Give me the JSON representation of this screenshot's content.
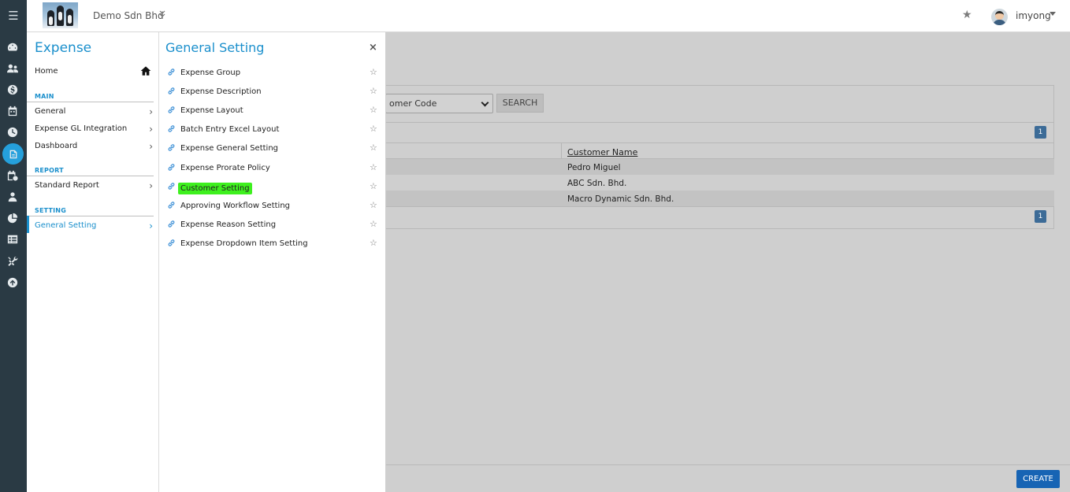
{
  "topbar": {
    "company": "Demo Sdn Bhd",
    "username": "imyong"
  },
  "rail": {
    "icons": [
      "menu-icon",
      "dashboard-icon",
      "users-icon",
      "dollar-icon",
      "calendar-icon",
      "clock-icon",
      "expense-icon",
      "calendar-check-icon",
      "person-icon",
      "pie-chart-icon",
      "table-icon",
      "tools-icon",
      "upload-icon"
    ],
    "active": "expense-icon"
  },
  "nav": {
    "title": "Expense",
    "home": "Home",
    "sections": [
      {
        "label": "MAIN",
        "items": [
          "General",
          "Expense GL Integration",
          "Dashboard"
        ]
      },
      {
        "label": "REPORT",
        "items": [
          "Standard Report"
        ]
      },
      {
        "label": "SETTING",
        "items": [
          "General Setting"
        ]
      }
    ],
    "active_item": "General Setting"
  },
  "flyout": {
    "title": "General Setting",
    "close": "×",
    "items": [
      "Expense Group",
      "Expense Description",
      "Expense Layout",
      "Batch Entry Excel Layout",
      "Expense General Setting",
      "Expense Prorate Policy",
      "Customer Setting",
      "Approving Workflow Setting",
      "Expense Reason Setting",
      "Expense Dropdown Item Setting"
    ],
    "highlighted": "Customer Setting"
  },
  "main": {
    "filter_value": "omer Code",
    "search_label": "SEARCH",
    "pager_top": "1",
    "pager_bottom": "1",
    "column_header": "Customer Name",
    "rows": [
      "Pedro Miguel",
      "ABC Sdn. Bhd.",
      "Macro Dynamic Sdn. Bhd."
    ],
    "create_label": "CREATE"
  },
  "colors": {
    "accent": "#1a8fcc",
    "rail": "#2a3a44",
    "highlight": "#3ef01e",
    "create_button": "#1764b4"
  }
}
